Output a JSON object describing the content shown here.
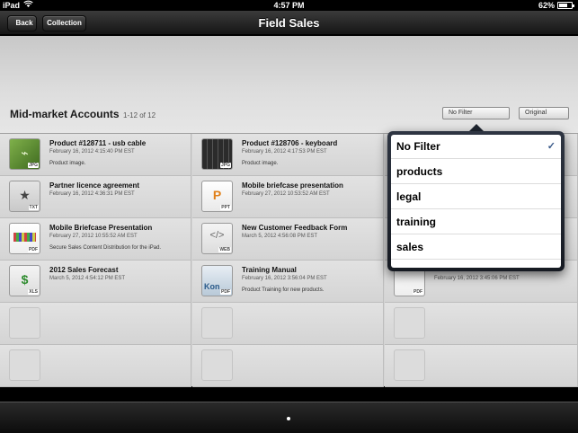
{
  "status": {
    "carrier": "iPad",
    "time": "4:57 PM",
    "battery": "62%",
    "battery_level": 0.62
  },
  "nav": {
    "back_label": "Back",
    "collection_label": "Collection",
    "title": "Field Sales"
  },
  "section": {
    "title": "Mid-market Accounts",
    "count": "1-12 of 12"
  },
  "filters": {
    "filter_label": "No Filter",
    "sort_label": "Original"
  },
  "items": [
    {
      "title": "Product #128711 - usb cable",
      "date": "February 16, 2012 4:15:40 PM EST",
      "desc": "Product image.",
      "type": "JPG",
      "icon": "usb-cable-thumbnail"
    },
    {
      "title": "Product #128706 - keyboard",
      "date": "February 16, 2012 4:17:53 PM EST",
      "desc": "Product image.",
      "type": "JPG",
      "icon": "keyboard-thumbnail"
    },
    {
      "title": "Partner licence agreement",
      "date": "February 16, 2012 4:36:31 PM EST",
      "desc": "",
      "type": "TXT",
      "icon": "text-document-icon"
    },
    {
      "title": "Mobile briefcase presentation",
      "date": "February 27, 2012 10:53:52 AM EST",
      "desc": "",
      "type": "PPT",
      "icon": "presentation-icon"
    },
    {
      "title": "Mobile Briefcase Presentation",
      "date": "February 27, 2012 10:55:52 AM EST",
      "desc": "Secure Sales Content Distribution for the iPad.",
      "type": "PDF",
      "icon": "pdf-document-icon"
    },
    {
      "title": "New Customer Feedback Form",
      "date": "March 5, 2012 4:56:08 PM EST",
      "desc": "",
      "type": "WEB",
      "icon": "web-page-icon"
    },
    {
      "title": "2012 Sales Forecast",
      "date": "March 5, 2012 4:54:12 PM EST",
      "desc": "",
      "type": "XLS",
      "icon": "spreadsheet-icon"
    },
    {
      "title": "Training Manual",
      "date": "February 16, 2012 3:56:04 PM EST",
      "desc": "Product Training for new products.",
      "type": "PDF",
      "icon": "manual-thumbnail"
    },
    {
      "title": "",
      "date": "February 16, 2012 3:45:06 PM EST",
      "desc": "",
      "type": "PDF",
      "icon": "pdf-document-icon"
    }
  ],
  "popover": {
    "options": [
      "No Filter",
      "products",
      "legal",
      "training",
      "sales"
    ],
    "selected": "No Filter",
    "check": "✓"
  },
  "colors": {
    "navbar": "#151515",
    "popover_frame": "#1f2530",
    "check": "#3a5a8a"
  }
}
